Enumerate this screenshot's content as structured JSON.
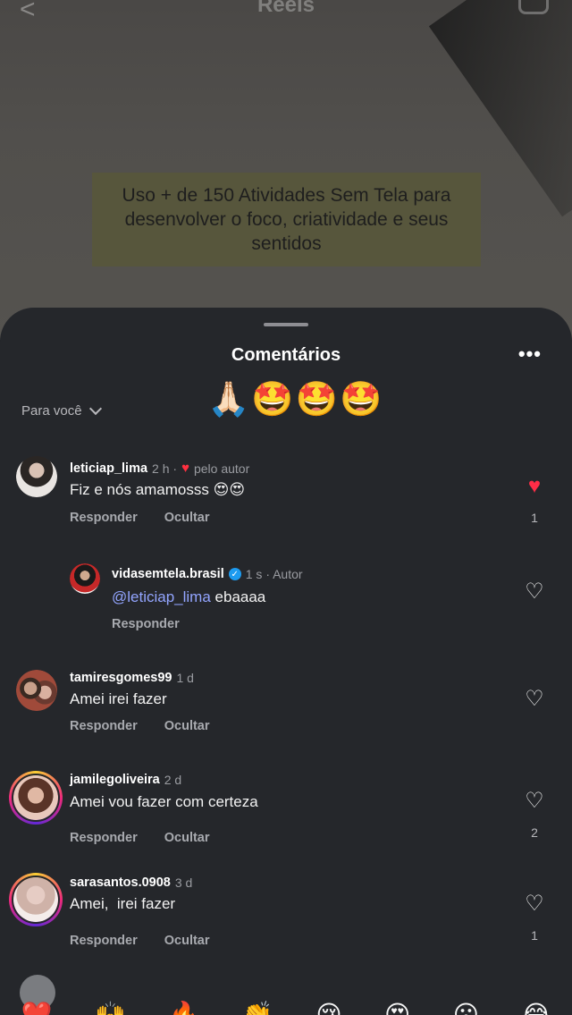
{
  "header": {
    "title": "Reels"
  },
  "video": {
    "caption": "Uso + de 150 Atividades Sem Tela para desenvolver o foco, criatividade e seus sentidos"
  },
  "sheet": {
    "title": "Comentários",
    "more_label": "•••",
    "filter_label": "Para você",
    "quick_emojis": "🙏🏻🤩🤩🤩"
  },
  "comments": [
    {
      "user": "leticiap_lima",
      "time": "2 h ·",
      "author_like": "pelo autor",
      "text": "Fiz e nós amamosss 😍😍",
      "reply": "Responder",
      "hide": "Ocultar",
      "liked": true,
      "likes": "1"
    },
    {
      "user": "vidasemtela.brasil",
      "time": "1 s · Autor",
      "mention": "@leticiap_lima",
      "text": " ebaaaa",
      "reply": "Responder",
      "liked": false
    },
    {
      "user": "tamiresgomes99",
      "time": "1 d",
      "text": "Amei irei fazer",
      "reply": "Responder",
      "hide": "Ocultar",
      "liked": false
    },
    {
      "user": "jamilegoliveira",
      "time": "2 d",
      "text": "Amei vou fazer com certeza",
      "reply": "Responder",
      "hide": "Ocultar",
      "liked": false,
      "likes": "2"
    },
    {
      "user": "sarasantos.0908",
      "time": "3 d",
      "text": "Amei,  irei fazer",
      "reply": "Responder",
      "hide": "Ocultar",
      "liked": false,
      "likes": "1"
    }
  ],
  "emoji_bar": [
    "❤️",
    "🙌",
    "🔥",
    "👏",
    "😢",
    "😍",
    "😮",
    "😂"
  ],
  "colors": {
    "sheet_bg": "#25272b",
    "like_red": "#ff2d47",
    "mention_blue": "#93a5ff",
    "caption_bg": "#57563c"
  }
}
